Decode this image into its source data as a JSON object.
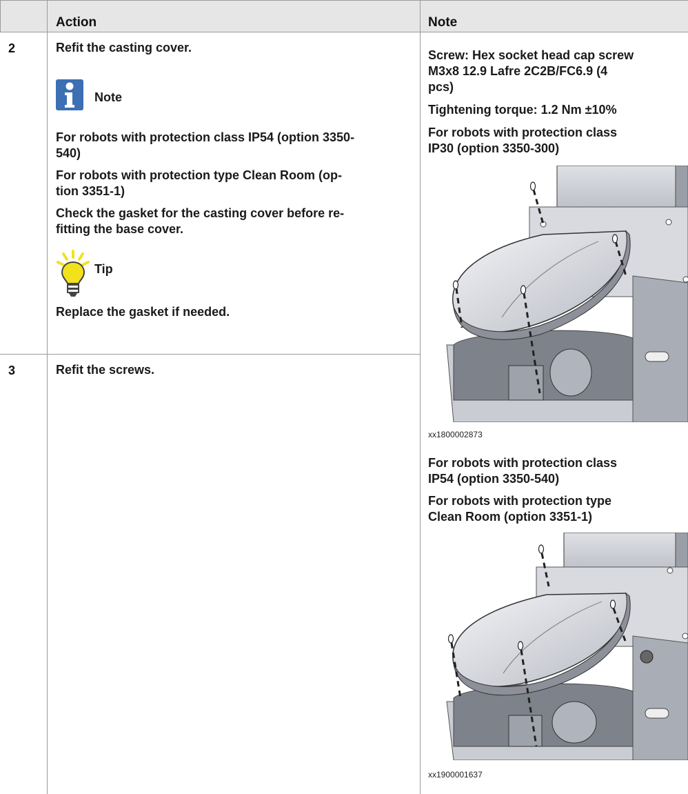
{
  "header": {
    "action": "Action",
    "note": "Note"
  },
  "rows": [
    {
      "step": "2",
      "action": {
        "main": "Refit the casting cover.",
        "note_title": "Note",
        "note_lines": [
          "For robots with protection class IP54 (option 3350-",
          "540)",
          "For robots with protection type Clean Room (op-",
          "tion 3351-1)",
          "Check the gasket for the casting cover before re-",
          "fitting the base cover."
        ],
        "tip_title": "Tip",
        "tip_text": "Replace the gasket if needed."
      }
    },
    {
      "step": "3",
      "action": {
        "main": "Refit the screws."
      }
    }
  ],
  "note_col": {
    "screw_lines": [
      "Screw: Hex socket head cap screw",
      "M3x8 12.9 Lafre 2C2B/FC6.9 (4",
      "pcs)"
    ],
    "torque": "Tightening torque: 1.2 Nm ±10%",
    "ip30_lines": [
      "For robots with protection class",
      "IP30 (option 3350-300)"
    ],
    "figure1_caption": "xx1800002873",
    "ip54_lines": [
      "For robots with protection class",
      "IP54 (option 3350-540)"
    ],
    "clean_lines": [
      "For robots with protection type",
      "Clean Room (option 3351-1)"
    ],
    "figure2_caption": "xx1900001637"
  },
  "colors": {
    "header_bg": "#e6e6e6",
    "note_icon": "#3c6fb3",
    "tip_icon": "#f2e21c",
    "rule": "#9a9a9a"
  },
  "icons": [
    "info-icon",
    "lightbulb-icon"
  ]
}
